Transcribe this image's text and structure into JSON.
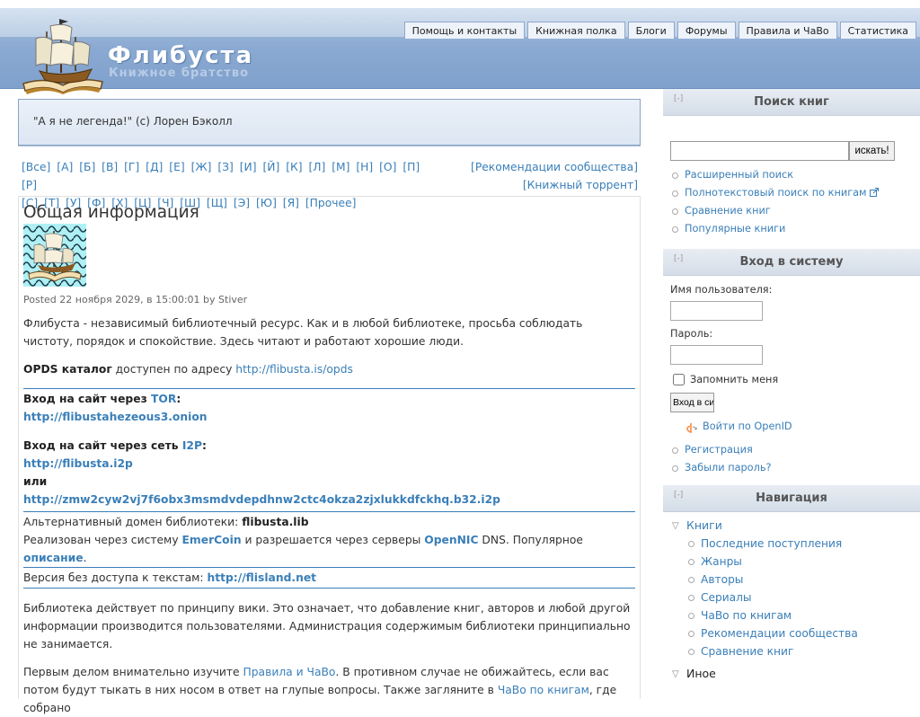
{
  "header": {
    "site_name": "Флибуста",
    "slogan": "Книжное братство",
    "tabs": [
      {
        "label": "Помощь и контакты"
      },
      {
        "label": "Книжная полка"
      },
      {
        "label": "Блоги"
      },
      {
        "label": "Форумы"
      },
      {
        "label": "Правила и ЧаВо"
      },
      {
        "label": "Статистика"
      }
    ]
  },
  "quote": "\"А я не легенда!\" (с) Лорен Бэколл",
  "alphabet": {
    "row1": [
      "[Все]",
      "[А]",
      "[Б]",
      "[В]",
      "[Г]",
      "[Д]",
      "[Е]",
      "[Ж]",
      "[З]",
      "[И]",
      "[Й]",
      "[К]",
      "[Л]",
      "[М]",
      "[Н]",
      "[О]",
      "[П]",
      "[Р]"
    ],
    "row2": [
      "[С]",
      "[Т]",
      "[У]",
      "[Ф]",
      "[Х]",
      "[Ц]",
      "[Ч]",
      "[Ш]",
      "[Щ]",
      "[Э]",
      "[Ю]",
      "[Я]",
      "[Прочее]"
    ],
    "recommendations": "[Рекомендации сообщества]",
    "torrent": "[Книжный торрент]"
  },
  "node": {
    "title": "Общая информация",
    "posted": "Posted 22 ноября 2029, в 15:00:01 by Stiver",
    "p1": "Флибуста - независимый библиотечный ресурс. Как и в любой библиотеке, просьба соблюдать чистоту, порядок и спокойствие. Здесь читают и работают хорошие люди.",
    "opds_label": "OPDS каталог",
    "opds_text": " доступен по адресу ",
    "opds_url": "http://flibusta.is/opds",
    "tor_label": "Вход на сайт через ",
    "tor_link": "TOR",
    "tor_colon": ":",
    "tor_url": "http://flibustahezeous3.onion",
    "i2p_label": "Вход на сайт через сеть ",
    "i2p_link": "I2P",
    "i2p_colon": ":",
    "i2p_url1": "http://flibusta.i2p",
    "i2p_or": "или",
    "i2p_url2": "http://zmw2cyw2vj7f6obx3msmdvdepdhnw2ctc4okza2zjxlukkdfckhq.b32.i2p",
    "alt_domain_text": "Альтернативный домен библиотеки: ",
    "alt_domain": "flibusta.lib",
    "impl_text1": "Реализован через систему ",
    "impl_emercoin": "EmerCoin",
    "impl_text2": " и разрешается через серверы ",
    "impl_opennic": "OpenNIC",
    "impl_text3": " DNS. Популярное ",
    "impl_desc": "описание",
    "impl_dot": ".",
    "noaccess_text": "Версия без доступа к текстам: ",
    "noaccess_url": "http://flisland.net",
    "p_wiki": "Библиотека действует по принципу вики. Это означает, что добавление книг, авторов и любой другой информации производится пользователями. Администрация содержимым библиотеки принципиально не занимается.",
    "p_rules1": "Первым делом внимательно изучите ",
    "p_rules_link": "Правила и ЧаВо",
    "p_rules2": ". В противном случае не обижайтесь, если вас потом будут тыкать в них носом в ответ на глупые вопросы. Также загляните в ",
    "p_rules_faq": "ЧаВо по книгам",
    "p_rules3": ", где собрано"
  },
  "search_block": {
    "title": "Поиск книг",
    "collapse": "[-]",
    "input_value": "",
    "button": "искать!",
    "links": [
      "Расширенный поиск",
      "Полнотекстовый поиск по книгам",
      "Сравнение книг",
      "Популярные книги"
    ]
  },
  "login_block": {
    "title": "Вход в систему",
    "collapse": "[-]",
    "username_label": "Имя пользователя:",
    "password_label": "Пароль:",
    "remember": "Запомнить меня",
    "login_button": "Вход в систему",
    "openid": "Войти по OpenID",
    "links": [
      "Регистрация",
      "Забыли пароль?"
    ]
  },
  "nav_block": {
    "title": "Навигация",
    "collapse": "[-]",
    "books": "Книги",
    "items": [
      "Последние поступления",
      "Жанры",
      "Авторы",
      "Сериалы",
      "ЧаВо по книгам",
      "Рекомендации сообщества",
      "Сравнение книг"
    ],
    "other": "Иное"
  }
}
